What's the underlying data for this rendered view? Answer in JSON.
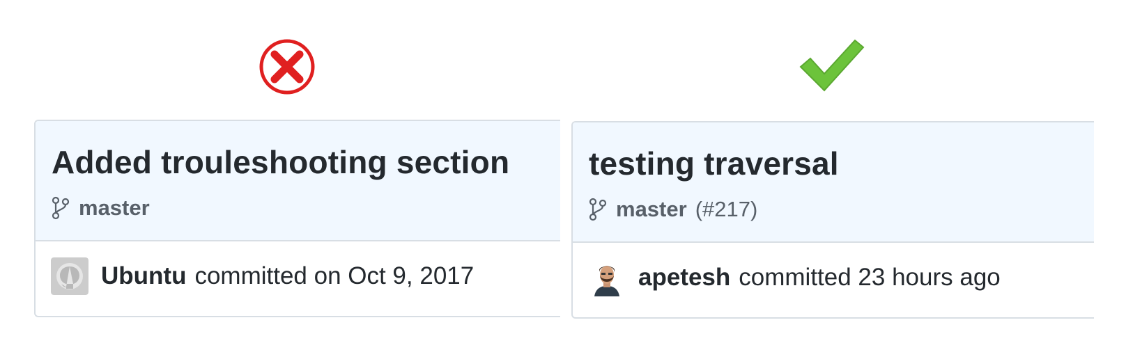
{
  "marks": {
    "left": "cross-icon",
    "right": "checkmark-icon",
    "left_color": "#e02020",
    "right_color": "#6cc33b"
  },
  "commits": [
    {
      "title": "Added trouleshooting section",
      "branch": "master",
      "pr": "",
      "author": "Ubuntu",
      "action": "committed on Oct 9, 2017",
      "avatar": "github-default-avatar"
    },
    {
      "title": "testing traversal",
      "branch": "master",
      "pr": "(#217)",
      "author": "apetesh",
      "action": "committed 23 hours ago",
      "avatar": "user-photo-avatar"
    }
  ],
  "colors": {
    "header_bg": "#f1f8ff",
    "border": "#d8dee4",
    "title": "#24292e",
    "muted": "#586069"
  }
}
